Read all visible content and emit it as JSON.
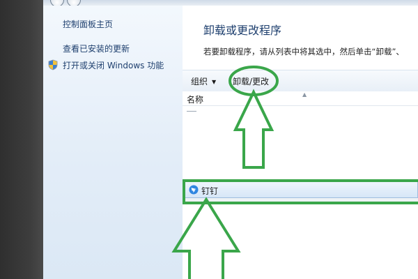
{
  "sidebar": {
    "items": [
      {
        "label": "控制面板主页"
      },
      {
        "label": "查看已安装的更新"
      },
      {
        "label": "打开或关闭 Windows 功能"
      }
    ]
  },
  "main": {
    "title": "卸载或更改程序",
    "description": "若要卸载程序，请从列表中将其选中，然后单击“卸载”、"
  },
  "toolbar": {
    "organize_label": "组织",
    "uninstall_label": "卸载/更改"
  },
  "list": {
    "column_header": "名称",
    "rows": [
      {
        "name": "钉钉",
        "selected": true
      }
    ]
  },
  "annotations": {
    "color": "#3aa64a"
  }
}
